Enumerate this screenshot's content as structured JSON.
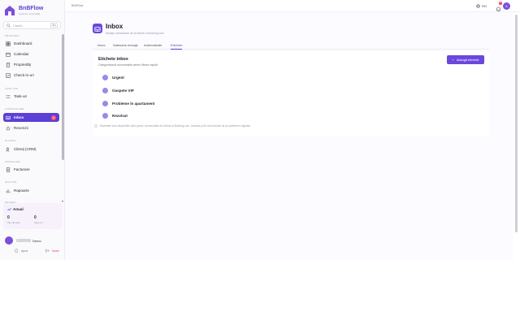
{
  "brand": {
    "name": "BnBFlow",
    "tagline": "Gestiune proprietăți",
    "collapse_icon": "chevron-left-icon"
  },
  "search": {
    "placeholder": "Caută...",
    "shortcut": "⌘K"
  },
  "sidebar": {
    "sections": [
      {
        "label": "PRINCIPAL",
        "items": [
          {
            "label": "Dashboard",
            "icon": "grid-icon"
          },
          {
            "label": "Calendar",
            "icon": "calendar-icon"
          },
          {
            "label": "Proprietăți",
            "icon": "building-icon"
          },
          {
            "label": "Check-in-uri",
            "icon": "checkin-icon"
          }
        ]
      },
      {
        "label": "TASK-URI",
        "items": [
          {
            "label": "Task-uri",
            "icon": "tasks-icon"
          }
        ]
      },
      {
        "label": "COMUNICARE",
        "items": [
          {
            "label": "Inbox",
            "icon": "inbox-icon",
            "badge": "0",
            "active": true
          },
          {
            "label": "Recenzii",
            "icon": "star-icon"
          }
        ]
      },
      {
        "label": "CLIENȚI",
        "items": [
          {
            "label": "Clienți (CRM)",
            "icon": "users-icon"
          }
        ]
      },
      {
        "label": "FINANCIAR",
        "items": [
          {
            "label": "Facturare",
            "icon": "invoice-icon"
          }
        ]
      },
      {
        "label": "ANALIZĂ",
        "items": [
          {
            "label": "Rapoarte",
            "icon": "chart-icon"
          }
        ]
      },
      {
        "label": "PACHET",
        "items": []
      }
    ],
    "trial": {
      "title": "Anual",
      "stats": [
        {
          "value": "0",
          "label": "Zile rămase"
        },
        {
          "value": "0",
          "label": "Task-uri"
        }
      ]
    },
    "user": {
      "name": "Demo"
    },
    "footer": {
      "theme_label": "Apus",
      "logout_label": "Ieșire"
    }
  },
  "topbar": {
    "breadcrumb": "BnBFlow",
    "lang": "RO",
    "notifications": "9",
    "avatar_letter": "A"
  },
  "page": {
    "title": "Inbox",
    "subtitle": "Mesaje centralizate de la Airbnb și Booking.com",
    "tabs": [
      "Inbox",
      "Șabloane mesaje",
      "Automatizări",
      "Etichete"
    ],
    "active_tab": 3,
    "panel": {
      "title": "Etichete inbox",
      "subtitle": "Categorisează conversațiile pentru filtrare rapidă",
      "add_button": "Adaugă etichetă",
      "labels": [
        "Urgent",
        "Oaspete VIP",
        "Probleme în apartament",
        "Rezolvat"
      ],
      "dot_color": "#9c88e8"
    },
    "note": "Etichetele sunt disponibile doar pentru conversațiile din Airbnb și Booking.com. Acestea pot fi sincronizate de pe platforme originale."
  },
  "colors": {
    "accent": "#5b3fd6",
    "badge": "#ff5470"
  }
}
